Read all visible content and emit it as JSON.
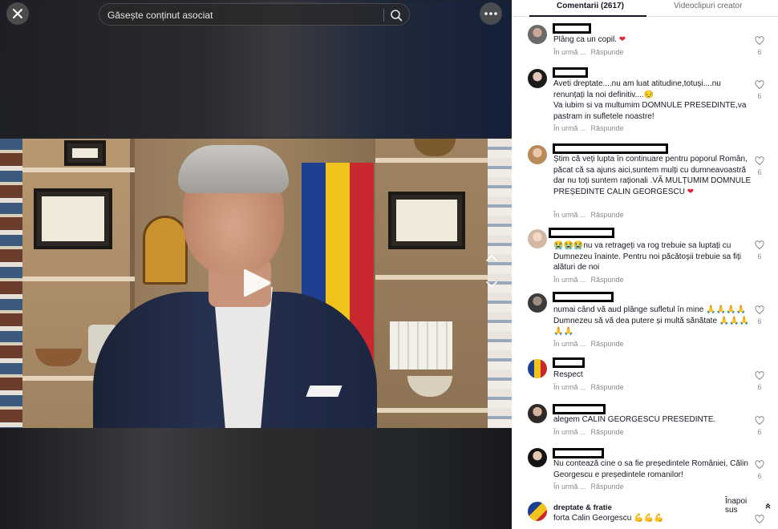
{
  "search": {
    "placeholder": "Găsește conținut asociat"
  },
  "tabs": [
    {
      "label": "Comentarii (2617)",
      "active": true
    },
    {
      "label": "Videoclipuri creator",
      "active": false
    }
  ],
  "colors": {
    "accent_text": "#161823",
    "muted": "#8a8b91",
    "heart_emoji": "#e0243a"
  },
  "icons": [
    "close-icon",
    "search-icon",
    "more-icon",
    "chevron-up-icon",
    "chevron-down-icon",
    "play-icon",
    "heart-outline-icon"
  ],
  "meta": {
    "time": "În urmă ...",
    "reply": "Răspunde"
  },
  "comments": [
    {
      "username": "",
      "text": "Plâng ca un copil.",
      "emoji": "❤",
      "likes": "6"
    },
    {
      "username": "",
      "text": "Aveti dreptate....nu am luat atitudine,totuși....nu renunțați la noi definitiv....😔\nVa iubim si va multumim DOMNULE PRESEDINTE,va pastram in sufletele noastre!",
      "emoji": "",
      "likes": "6"
    },
    {
      "username": "",
      "text": "Știm că veți lupta în continuare pentru poporul Român, păcat că sa ajuns aici,suntem mulți cu dumneavoastră dar nu toți suntem raționali .VĂ MULȚUMIM DOMNULE PREȘEDINTE CALIN GEORGESCU",
      "emoji": "❤",
      "likes": "6"
    },
    {
      "username": "",
      "text": "😭😭😭nu va retrageți va rog trebuie sa luptați cu Dumnezeu înainte. Pentru noi păcătoșii trebuie sa fiți alături de noi",
      "emoji": "",
      "likes": "6"
    },
    {
      "username": "",
      "text": "numai când vă aud plânge sufletul în mine 🙏🙏🙏🙏Dumnezeu să vă dea putere și multă sănătate 🙏🙏🙏🙏🙏",
      "emoji": "",
      "likes": "6"
    },
    {
      "username": "",
      "text": "Respect",
      "emoji": "",
      "likes": "6"
    },
    {
      "username": "",
      "text": "alegem CALIN GEORGESCU PRESEDINTE.",
      "emoji": "",
      "likes": "6"
    },
    {
      "username": "",
      "text": "Nu contează cine o sa fie președintele României, Călin Georgescu e președintele romanilor!",
      "emoji": "",
      "likes": "6"
    },
    {
      "username": "dreptate & fratie",
      "text": "forta Calin Georgescu 💪💪💪",
      "emoji": "",
      "likes": ""
    }
  ],
  "back_to_top": {
    "label": "Înapoi sus"
  }
}
